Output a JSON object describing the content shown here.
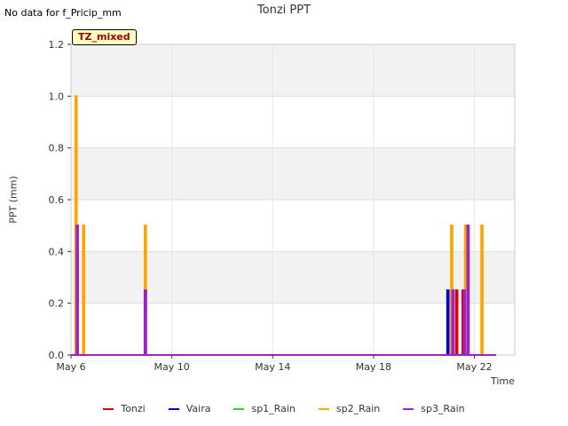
{
  "header": {
    "no_data_text": "No data for f_Pricip_mm",
    "title": "Tonzi PPT",
    "badge": "TZ_mixed"
  },
  "chart_data": {
    "type": "line",
    "title": "Tonzi PPT",
    "xlabel": "Time",
    "ylabel": "PPT (mm)",
    "xlim": [
      "2024-05-06",
      "2024-05-23.6"
    ],
    "ylim": [
      0,
      1.2
    ],
    "yticks": [
      "0.0",
      "0.2",
      "0.4",
      "0.6",
      "0.8",
      "1.0",
      "1.2"
    ],
    "xticks": [
      {
        "label": "May 6",
        "day": 6
      },
      {
        "label": "May 10",
        "day": 10
      },
      {
        "label": "May 14",
        "day": 14
      },
      {
        "label": "May 18",
        "day": 18
      },
      {
        "label": "May 22",
        "day": 22
      }
    ],
    "x_range_days": [
      6,
      23.6
    ],
    "line_end_day": 22.85,
    "grid": true,
    "series": [
      {
        "name": "Tonzi",
        "color": "#dd0000",
        "spikes": [
          {
            "day": 21.1,
            "value": 0.25
          },
          {
            "day": 21.3,
            "value": 0.25
          },
          {
            "day": 21.55,
            "value": 0.25
          }
        ]
      },
      {
        "name": "Vaira",
        "color": "#0000cc",
        "spikes": [
          {
            "day": 8.95,
            "value": 0.25
          },
          {
            "day": 20.95,
            "value": 0.25
          },
          {
            "day": 21.7,
            "value": 0.5
          }
        ]
      },
      {
        "name": "sp1_Rain",
        "color": "#22dd22",
        "spikes": []
      },
      {
        "name": "sp2_Rain",
        "color": "#ffa500",
        "spikes": [
          {
            "day": 6.2,
            "value": 1.0
          },
          {
            "day": 6.5,
            "value": 0.5
          },
          {
            "day": 8.95,
            "value": 0.5
          },
          {
            "day": 21.1,
            "value": 0.5
          },
          {
            "day": 21.65,
            "value": 0.5
          },
          {
            "day": 22.3,
            "value": 0.5
          }
        ]
      },
      {
        "name": "sp3_Rain",
        "color": "#9922cc",
        "spikes": [
          {
            "day": 6.25,
            "value": 0.5
          },
          {
            "day": 8.95,
            "value": 0.25
          },
          {
            "day": 21.15,
            "value": 0.25
          },
          {
            "day": 21.6,
            "value": 0.25
          },
          {
            "day": 21.75,
            "value": 0.5
          }
        ]
      }
    ]
  }
}
